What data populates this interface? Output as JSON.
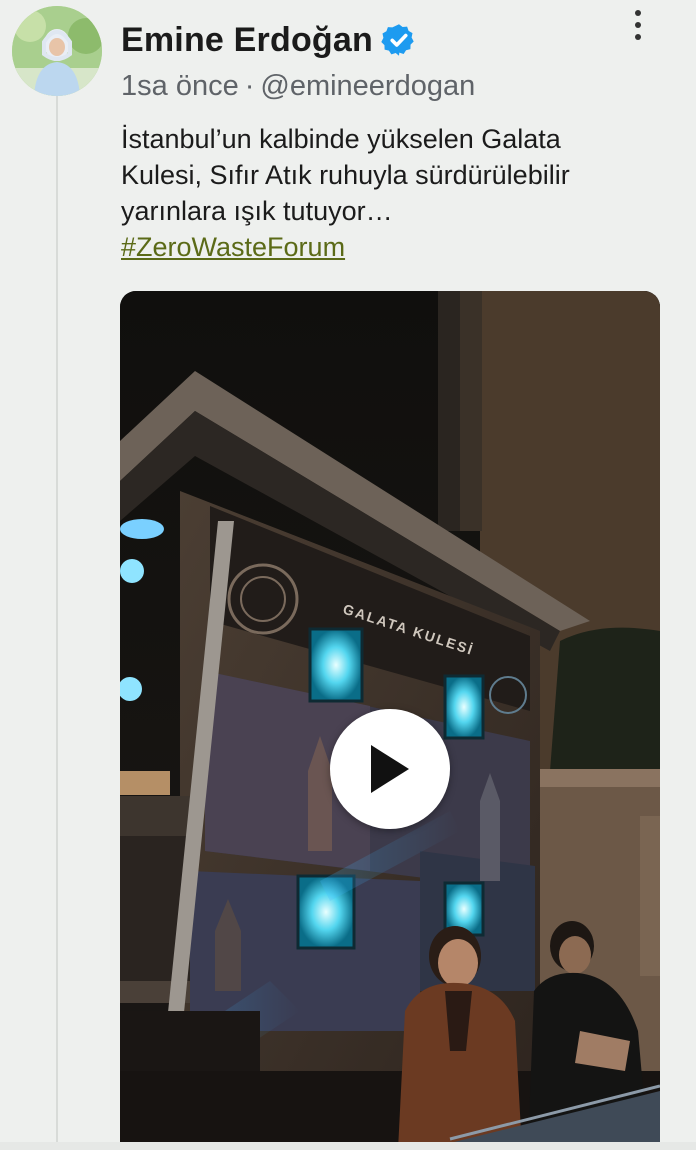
{
  "post": {
    "author_name": "Emine Erdoğan",
    "verified": true,
    "time": "1sa önce",
    "separator": "·",
    "handle": "@emineerdogan",
    "text_lines": [
      "İstanbul’un kalbinde yükselen Galata",
      "Kulesi, Sıfır Atık ruhuyla sürdürülebilir",
      "yarınlara ışık tutuyor…"
    ],
    "hashtag": "#ZeroWasteForum"
  },
  "media": {
    "type": "video",
    "sign_text": "GALATA KULESİ"
  },
  "icons": {
    "verified": "verified-badge-icon",
    "more": "more-options-icon",
    "play": "play-icon"
  },
  "colors": {
    "verified": "#1d9bf0",
    "hashtag": "#5b6a17",
    "meta": "#5f6368",
    "background": "#eef0ee"
  }
}
